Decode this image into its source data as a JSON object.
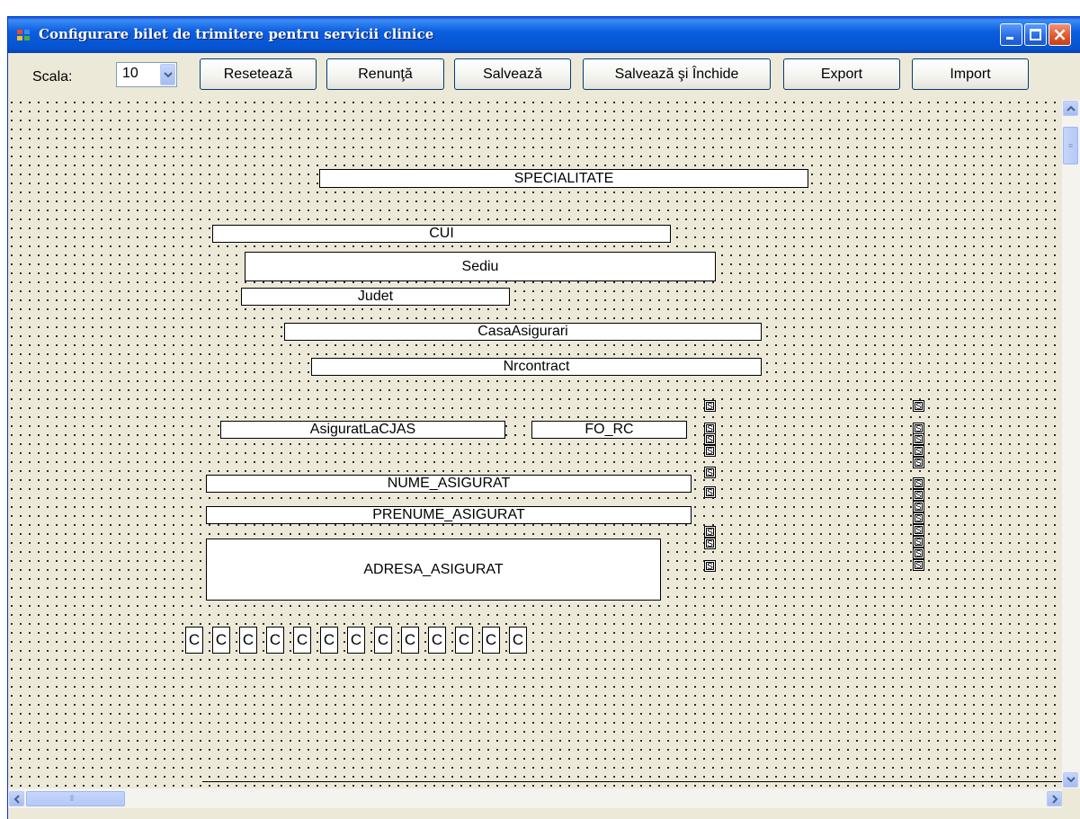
{
  "window": {
    "title": "Configurare bilet de trimitere pentru servicii clinice"
  },
  "toolbar": {
    "scala_label": "Scala:",
    "scala_value": "10",
    "buttons": {
      "reset": "Resetează",
      "cancel": "Renunţă",
      "save": "Salvează",
      "save_close": "Salvează şi Închide",
      "export": "Export",
      "import": "Import"
    }
  },
  "fields": {
    "specialitate": "SPECIALITATE",
    "cui": "CUI",
    "sediu": "Sediu",
    "judet": "Judet",
    "casa_asigurari": "CasaAsigurari",
    "nr_contract": "Nrcontract",
    "asigurat_la_cjas": "AsiguratLaCJAS",
    "fo_rc": "FO_RC",
    "nume_asigurat": "NUME_ASIGURAT",
    "prenume_asigurat": "PRENUME_ASIGURAT",
    "adresa_asigurat": "ADRESA_ASIGURAT"
  },
  "checkbox_letter": "S",
  "code_boxes": [
    "C",
    "C",
    "C",
    "C",
    "C",
    "C",
    "C",
    "C",
    "C",
    "C",
    "C",
    "C",
    "C"
  ]
}
